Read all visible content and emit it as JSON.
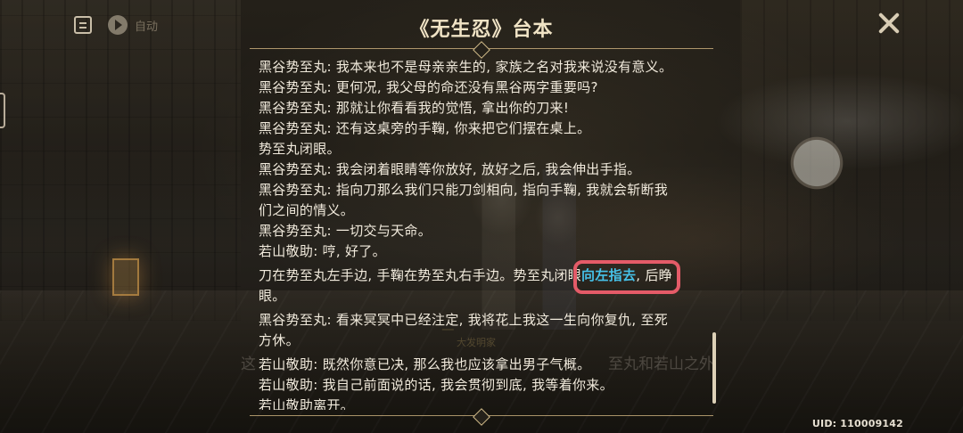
{
  "header": {
    "title": "《无生忍》台本",
    "auto_label": "自动"
  },
  "background": {
    "speaker_name": "ㅡ",
    "speaker_title": "大发明家",
    "subtitle_left": "这",
    "subtitle_right": "至丸和若山之外"
  },
  "script": [
    "黑谷势至丸: 我本来也不是母亲亲生的, 家族之名对我来说没有意义。",
    "黑谷势至丸: 更何况, 我父母的命还没有黑谷两字重要吗?",
    "黑谷势至丸: 那就让你看看我的觉悟, 拿出你的刀来!",
    "黑谷势至丸: 还有这桌旁的手鞠, 你来把它们摆在桌上。",
    "势至丸闭眼。",
    "黑谷势至丸: 我会闭着眼睛等你放好, 放好之后, 我会伸出手指。",
    "黑谷势至丸: 指向刀那么我们只能刀剑相向, 指向手鞠, 我就会斩断我",
    "们之间的情义。",
    "黑谷势至丸: 一切交与天命。",
    "若山敬助: 哼, 好了。",
    {
      "before": "刀在势至丸左手边, 手鞠在势至丸右手边。势至丸闭眼",
      "highlight": "向左指去",
      "after": ", 后睁"
    },
    "眼。",
    "黑谷势至丸: 看来冥冥中已经注定, 我将花上我这一生向你复仇, 至死",
    "方休。",
    "若山敬助: 既然你意已决, 那么我也应该拿出男子气概。",
    "若山敬助: 我自己前面说的话, 我会贯彻到底, 我等着你来。",
    "若山敬助离开。"
  ],
  "footer": {
    "uid": "UID: 110009142"
  },
  "colors": {
    "highlight": "#46c1e8",
    "callout": "#e45b68",
    "text": "#f1eadc",
    "title": "#f0e3c5"
  },
  "icons": {
    "menu": "document-icon",
    "auto": "play-icon",
    "close": "close-icon"
  }
}
